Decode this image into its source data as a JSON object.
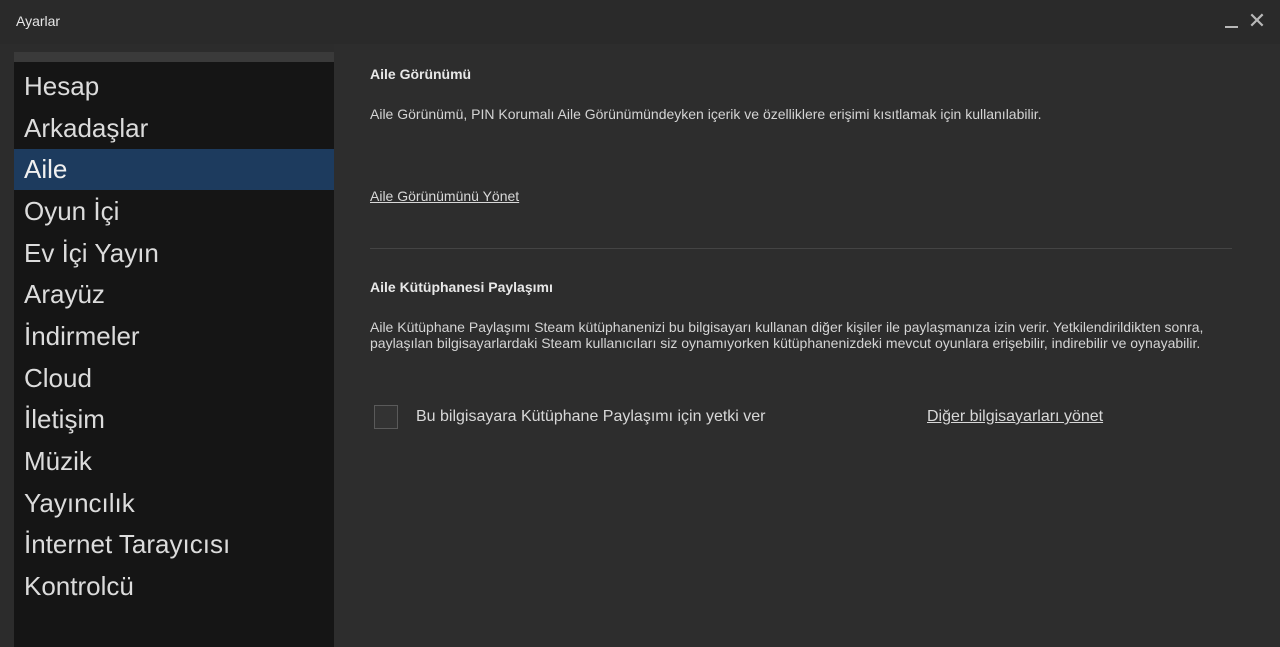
{
  "window": {
    "title": "Ayarlar",
    "minimize_glyph": "_",
    "close_glyph": "✕"
  },
  "sidebar": {
    "items": [
      {
        "label": "Hesap"
      },
      {
        "label": "Arkadaşlar"
      },
      {
        "label": "Aile",
        "active": true
      },
      {
        "label": "Oyun İçi"
      },
      {
        "label": "Ev İçi Yayın"
      },
      {
        "label": "Arayüz"
      },
      {
        "label": "İndirmeler"
      },
      {
        "label": "Cloud"
      },
      {
        "label": "İletişim"
      },
      {
        "label": "Müzik"
      },
      {
        "label": "Yayıncılık"
      },
      {
        "label": "İnternet Tarayıcısı"
      },
      {
        "label": "Kontrolcü"
      }
    ]
  },
  "family_view": {
    "title": "Aile Görünümü",
    "description": "Aile Görünümü, PIN Korumalı Aile Görünümündeyken içerik ve özelliklere erişimi kısıtlamak için kullanılabilir.",
    "manage_link": "Aile Görünümünü Yönet"
  },
  "library_sharing": {
    "title": "Aile Kütüphanesi Paylaşımı",
    "description": "Aile Kütüphane Paylaşımı Steam kütüphanenizi bu bilgisayarı kullanan diğer kişiler ile paylaşmanıza izin verir. Yetkilendirildikten sonra, paylaşılan bilgisayarlardaki Steam kullanıcıları siz oynamıyorken kütüphanenizdeki mevcut oyunlara erişebilir, indirebilir ve oynayabilir.",
    "authorize_label": "Bu bilgisayara Kütüphane Paylaşımı için yetki ver",
    "authorize_checked": false,
    "manage_other_link": "Diğer bilgisayarları yönet"
  },
  "colors": {
    "sidebar_active": "#1d3b5e",
    "sidebar_bg": "#151515",
    "content_bg": "#2d2d2d"
  }
}
